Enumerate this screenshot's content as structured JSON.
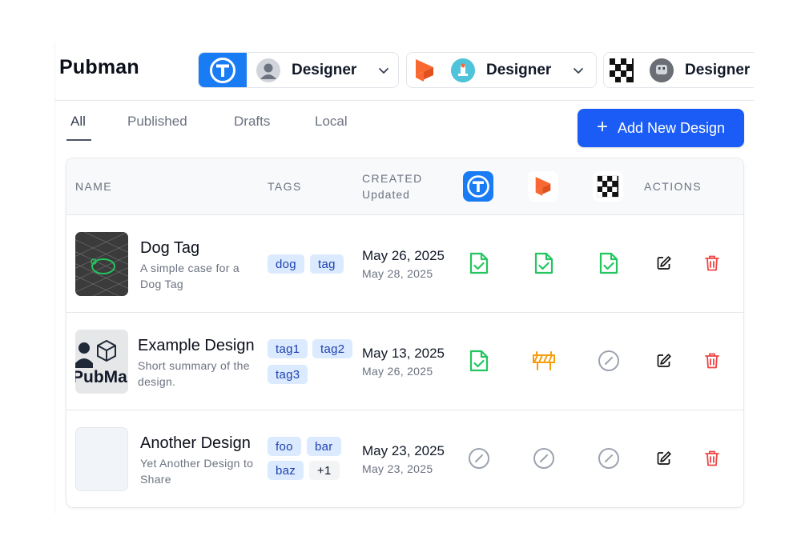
{
  "app": {
    "title": "Pubman"
  },
  "sites": [
    {
      "label": "Designer",
      "logo": "thingiverse-logo-icon",
      "avatar": "user-avatar-icon"
    },
    {
      "label": "Designer",
      "logo": "printables-logo-icon",
      "avatar": "user-avatar-icon"
    },
    {
      "label": "Designer",
      "logo": "makerworld-logo-icon",
      "avatar": "user-avatar-icon"
    }
  ],
  "tabs": [
    {
      "label": "All",
      "active": true
    },
    {
      "label": "Published",
      "active": false
    },
    {
      "label": "Drafts",
      "active": false
    },
    {
      "label": "Local",
      "active": false
    }
  ],
  "add_button": {
    "label": "Add New Design",
    "icon": "plus-icon"
  },
  "table": {
    "headers": {
      "name": "NAME",
      "tags": "TAGS",
      "created": "CREATED",
      "updated": "Updated",
      "actions": "ACTIONS"
    },
    "rows": [
      {
        "name": "Dog Tag",
        "description_lines": [
          "A simple case for a",
          "Dog Tag"
        ],
        "tags": [
          "dog",
          "tag"
        ],
        "created": "May 26, 2025",
        "updated": "May 28, 2025",
        "status": [
          "published",
          "published",
          "published"
        ]
      },
      {
        "name": "Example Design",
        "description_lines": [
          "Short summary of the",
          "design."
        ],
        "tags": [
          "tag1",
          "tag2",
          "tag3"
        ],
        "created": "May 13, 2025",
        "updated": "May 26, 2025",
        "status": [
          "published",
          "under-construction",
          "not-published"
        ]
      },
      {
        "name": "Another Design",
        "description_lines": [
          "Yet Another Design to",
          "Share"
        ],
        "tags": [
          "foo",
          "bar",
          "baz",
          "+1"
        ],
        "created": "May 23, 2025",
        "updated": "May 23, 2025",
        "status": [
          "not-published",
          "not-published",
          "not-published"
        ]
      }
    ],
    "thumb_texts": {
      "row2": "PubMa"
    }
  },
  "colors": {
    "primary": "#1a5cf5",
    "thingiverse": "#1a7cf5",
    "printables": "#fa6831",
    "published": "#22c55e",
    "construction": "#f59e0b",
    "not_published": "#9ca3af",
    "delete": "#ef4444",
    "tag_bg": "#dbeafe",
    "tag_text": "#1e40af"
  }
}
